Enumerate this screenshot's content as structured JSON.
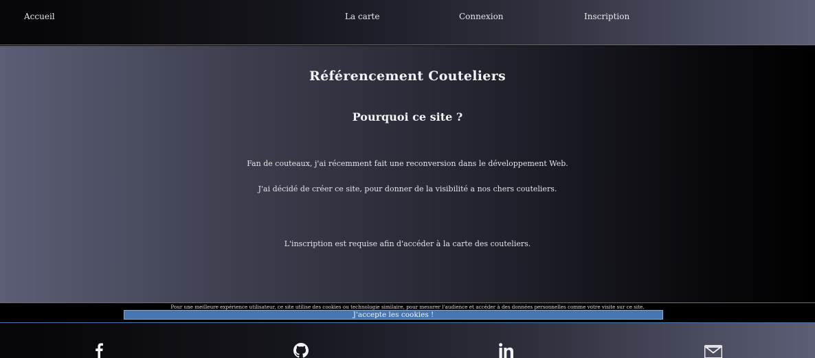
{
  "nav": {
    "home": "Accueil",
    "map": "La carte",
    "login": "Connexion",
    "signup": "Inscription"
  },
  "main": {
    "title": "Référencement Couteliers",
    "subtitle": "Pourquoi ce site ?",
    "paragraphs": [
      "Fan de couteaux, j'ai récemment fait une reconversion dans le développement Web.",
      "J'ai décidé de créer ce site, pour donner de la visibilité a nos chers couteliers.",
      "L'inscription est requise afin d'accéder à la carte des couteliers."
    ]
  },
  "cookie": {
    "text": "Pour une meilleure expérience utilisateur, ce site utilise des cookies ou technologie similaire, pour mesurer l'audience et accéder à des données personnelles comme votre visite sur ce site.",
    "button": "J'accepte les cookies !"
  },
  "footer": {
    "icons": [
      "facebook-icon",
      "github-icon",
      "linkedin-icon",
      "mail-icon"
    ]
  },
  "colors": {
    "accent_border": "#4b78a8",
    "cookie_button": "#4675b0"
  }
}
